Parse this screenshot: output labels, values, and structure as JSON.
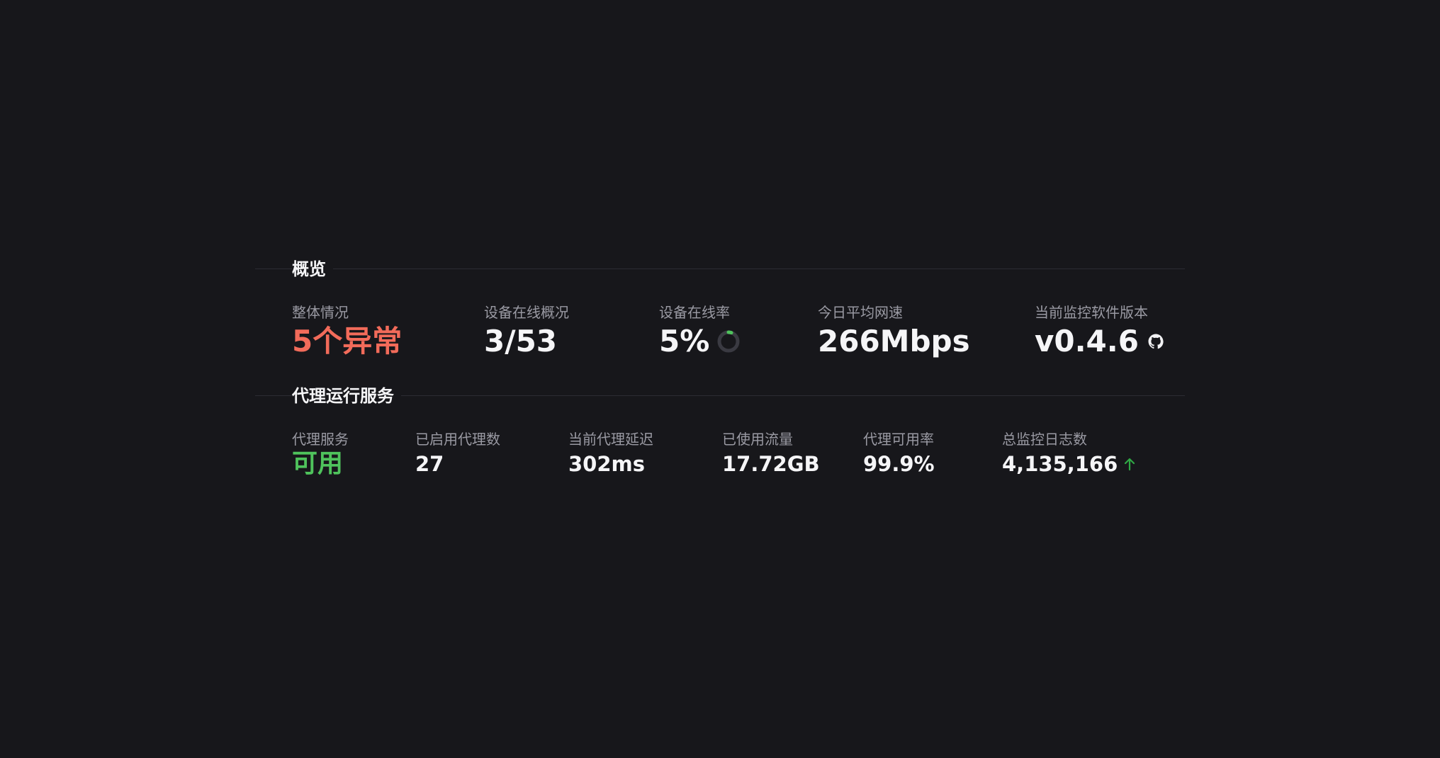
{
  "overview": {
    "title": "概览",
    "stats": [
      {
        "label": "整体情况",
        "value": "5个异常"
      },
      {
        "label": "设备在线概况",
        "value": "3/53"
      },
      {
        "label": "设备在线率",
        "value": "5%",
        "progress": 0.05
      },
      {
        "label": "今日平均网速",
        "value": "266Mbps"
      },
      {
        "label": "当前监控软件版本",
        "value": "v0.4.6",
        "icon": "github-icon"
      }
    ]
  },
  "proxy": {
    "title": "代理运行服务",
    "stats": [
      {
        "label": "代理服务",
        "value": "可用"
      },
      {
        "label": "已启用代理数",
        "value": "27"
      },
      {
        "label": "当前代理延迟",
        "value": "302ms"
      },
      {
        "label": "已使用流量",
        "value": "17.72GB"
      },
      {
        "label": "代理可用率",
        "value": "99.9%"
      },
      {
        "label": "总监控日志数",
        "value": "4,135,166",
        "icon": "arrow-up-icon"
      }
    ]
  },
  "colors": {
    "background": "#17171b",
    "alert_red": "#f26b5a",
    "ok_green": "#4fc35c",
    "label_gray": "#9a9aa3"
  }
}
